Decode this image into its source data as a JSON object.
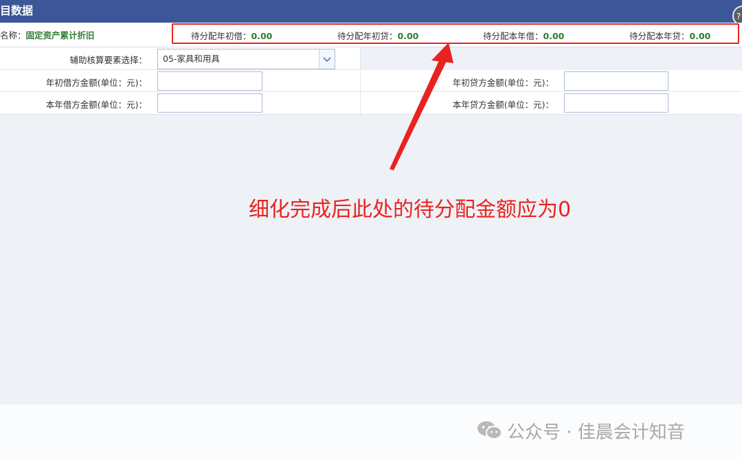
{
  "titlebar": {
    "title": "目数据",
    "close_glyph": "?"
  },
  "info": {
    "subject_label": "名称：",
    "subject_value": "固定资产累计折旧",
    "pending": [
      {
        "label": "待分配年初借：",
        "value": "0.00"
      },
      {
        "label": "待分配年初贷：",
        "value": "0.00"
      },
      {
        "label": "待分配本年借：",
        "value": "0.00"
      },
      {
        "label": "待分配本年贷：",
        "value": "0.00"
      }
    ]
  },
  "form": {
    "aux_label": "辅助核算要素选择：",
    "aux_value": "05-家具和用具",
    "opening_debit_label": "年初借方金额(单位：元)：",
    "opening_credit_label": "年初贷方金额(单位：元)：",
    "current_debit_label": "本年借方金额(单位：元)：",
    "current_credit_label": "本年贷方金额(单位：元)：",
    "opening_debit_value": "",
    "opening_credit_value": "",
    "current_debit_value": "",
    "current_credit_value": ""
  },
  "annotation": {
    "text": "细化完成后此处的待分配金额应为0",
    "color": "#e8231f"
  },
  "watermark": {
    "text": "公众号 · 佳晨会计知音"
  },
  "colors": {
    "titlebar": "#3c5698",
    "value_green": "#2f7d32",
    "highlight_red": "#e8231f"
  }
}
